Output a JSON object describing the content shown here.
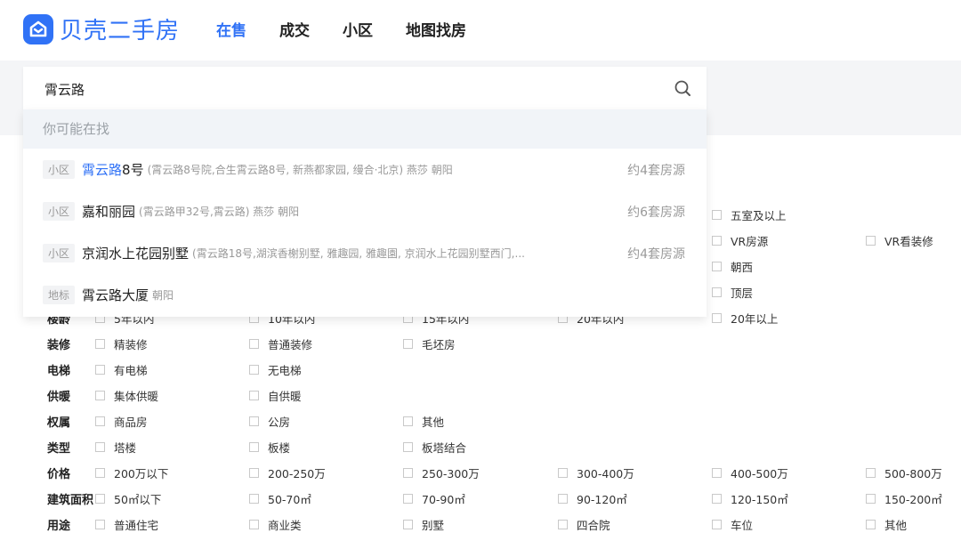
{
  "header": {
    "logo_text": "贝壳二手房",
    "nav": [
      "在售",
      "成交",
      "小区",
      "地图找房"
    ]
  },
  "search": {
    "value": "霄云路",
    "placeholder": ""
  },
  "dropdown": {
    "header": "你可能在找",
    "items": [
      {
        "tag": "小区",
        "name_hl": "霄云路",
        "name_rest": "8号",
        "detail": "(霄云路8号院,合生霄云路8号, 新燕都家园, 缦合·北京) 燕莎 朝阳",
        "count": "约4套房源"
      },
      {
        "tag": "小区",
        "name_hl": "",
        "name_rest": "嘉和丽园",
        "detail": "(霄云路甲32号,霄云路) 燕莎 朝阳",
        "count": "约6套房源"
      },
      {
        "tag": "小区",
        "name_hl": "",
        "name_rest": "京润水上花园别墅",
        "detail": "(霄云路18号,湖滨香榭别墅, 雅趣园, 雅趣園, 京润水上花园别墅西门,...",
        "count": "约4套房源"
      },
      {
        "tag": "地标",
        "name_hl": "",
        "name_rest": "霄云路大厦",
        "detail": "朝阳",
        "count": ""
      }
    ]
  },
  "filters": [
    {
      "label": "",
      "options": [
        "",
        "",
        "",
        "",
        "五室及以上",
        ""
      ]
    },
    {
      "label": "",
      "options": [
        "",
        "",
        "",
        "",
        "VR房源",
        "VR看装修"
      ]
    },
    {
      "label": "",
      "options": [
        "",
        "",
        "",
        "",
        "朝西",
        ""
      ]
    },
    {
      "label": "",
      "options": [
        "",
        "",
        "",
        "",
        "顶层",
        ""
      ]
    },
    {
      "label": "楼龄",
      "options": [
        "5年以内",
        "10年以内",
        "15年以内",
        "20年以内",
        "20年以上",
        ""
      ]
    },
    {
      "label": "装修",
      "options": [
        "精装修",
        "普通装修",
        "毛坯房",
        "",
        "",
        ""
      ]
    },
    {
      "label": "电梯",
      "options": [
        "有电梯",
        "无电梯",
        "",
        "",
        "",
        ""
      ]
    },
    {
      "label": "供暖",
      "options": [
        "集体供暖",
        "自供暖",
        "",
        "",
        "",
        ""
      ]
    },
    {
      "label": "权属",
      "options": [
        "商品房",
        "公房",
        "其他",
        "",
        "",
        ""
      ]
    },
    {
      "label": "类型",
      "options": [
        "塔楼",
        "板楼",
        "板塔结合",
        "",
        "",
        ""
      ]
    },
    {
      "label": "价格",
      "options": [
        "200万以下",
        "200-250万",
        "250-300万",
        "300-400万",
        "400-500万",
        "500-800万"
      ]
    },
    {
      "label": "建筑面积",
      "options": [
        "50㎡以下",
        "50-70㎡",
        "70-90㎡",
        "90-120㎡",
        "120-150㎡",
        "150-200㎡"
      ]
    },
    {
      "label": "用途",
      "options": [
        "普通住宅",
        "商业类",
        "别墅",
        "四合院",
        "车位",
        "其他"
      ]
    }
  ],
  "colors": {
    "brand": "#3072f6",
    "muted": "#9a9a9a"
  }
}
